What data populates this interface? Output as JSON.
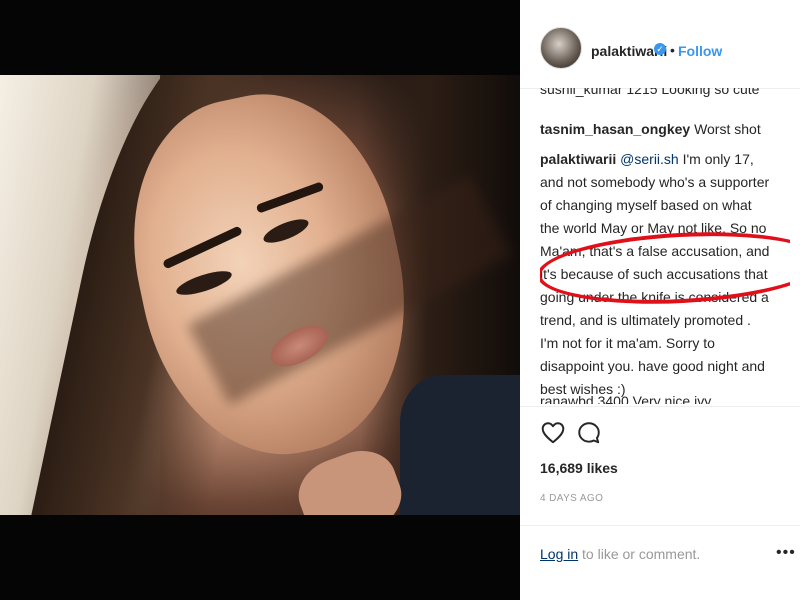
{
  "post": {
    "username": "palaktiwarii",
    "verified_glyph": "✓",
    "dot": "•",
    "follow_label": "Follow"
  },
  "comments": {
    "cut_top": "sushil_kumar 1215 Looking so cute",
    "items": [
      {
        "user": "tasnim_hasan_ongkey",
        "text": "Worst shot"
      },
      {
        "user": "palaktiwarii",
        "mention": "@serii.sh",
        "text": "I'm only 17, and not somebody who's a supporter of changing myself based on what the world May or May not like. So no Ma'am, that's a false accusation, and it's because of such accusations that going under the knife is considered a trend, and is ultimately promoted . I'm not for it ma'am. Sorry to disappoint you. have good night and best wishes :)"
      }
    ],
    "cut_bottom": "ranawbd 3400 Very nice ivy"
  },
  "actions": {
    "like_icon": "heart-outline-icon",
    "comment_icon": "comment-bubble-icon"
  },
  "likes": "16,689 likes",
  "timestamp": "4 DAYS AGO",
  "footer": {
    "login_link": "Log in",
    "login_rest": " to like or comment.",
    "more_label": "•••"
  },
  "colors": {
    "accent": "#3897f0",
    "highlight": "#e0101a",
    "text": "#262626",
    "muted": "#999999"
  }
}
